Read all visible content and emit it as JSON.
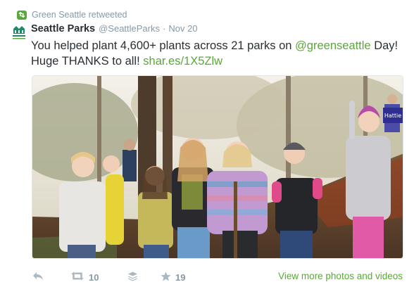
{
  "retweet": {
    "label": "Green Seattle retweeted",
    "icon": "retweet-icon",
    "color": "#5aa838"
  },
  "tweet": {
    "author_name": "Seattle Parks",
    "author_handle": "@SeattleParks",
    "separator": "·",
    "date": "Nov 20",
    "text_line1_prefix": "You helped plant 4,600+ plants across 21 parks on ",
    "mention": "@greenseattle",
    "text_line1_suffix": " Day!",
    "text_line2_prefix": "Huge THANKS to all! ",
    "link": "shar.es/1X5Zlw",
    "avatar_logo_text": "SEATTLE PARKS AND RECREATION",
    "photo_sign_text": "Hattie"
  },
  "actions": {
    "reply_icon": "reply-icon",
    "retweet_icon": "retweet-icon",
    "retweet_count": "10",
    "buffer_icon": "stack-icon",
    "favorite_icon": "star-icon",
    "favorite_count": "19",
    "view_more_label": "View more photos and videos"
  },
  "colors": {
    "text": "#292f33",
    "muted": "#8899a6",
    "link": "#3b94d9",
    "green": "#5aa838",
    "action_gray": "#aab8c2"
  }
}
